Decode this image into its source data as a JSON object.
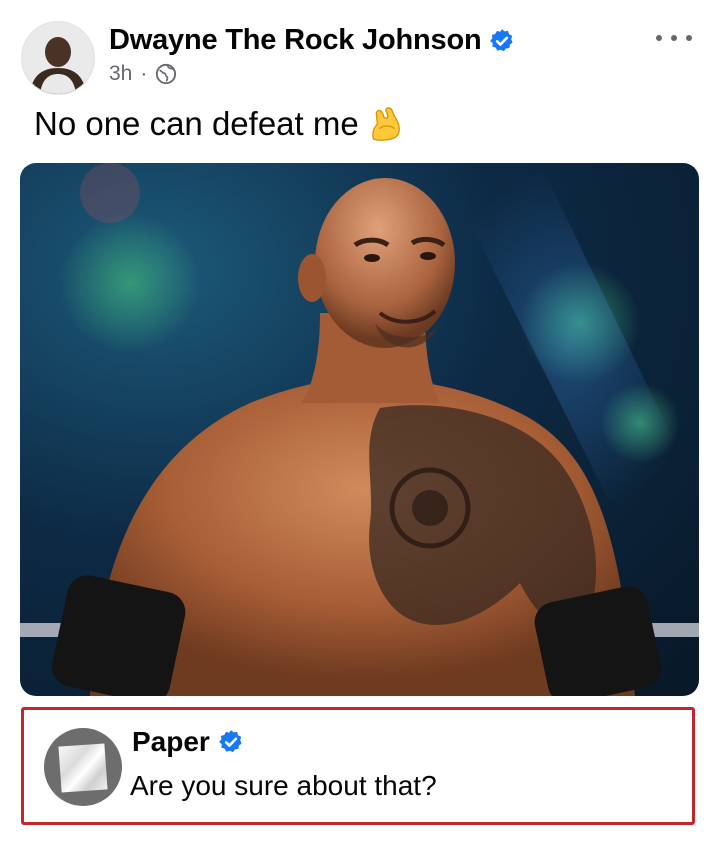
{
  "post": {
    "author": "Dwayne The Rock Johnson",
    "time": "3h",
    "separator": "·",
    "text": "No one can defeat me",
    "emoji_icon": "flexed-biceps-icon"
  },
  "comment": {
    "author": "Paper",
    "text": "Are you sure about that?"
  },
  "colors": {
    "verified_blue": "#1877f2",
    "meta_gray": "#65676b",
    "highlight_border": "#c0262c"
  }
}
